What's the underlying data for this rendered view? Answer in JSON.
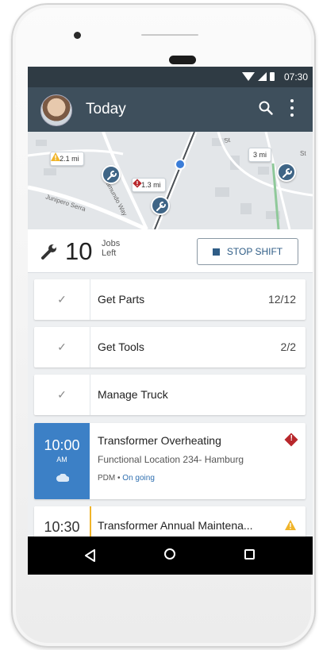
{
  "status_bar": {
    "time": "07:30"
  },
  "app_bar": {
    "title": "Today"
  },
  "map": {
    "callouts": [
      {
        "text": "2.1 mi",
        "severity": "warning"
      },
      {
        "text": "1.3 mi",
        "severity": "critical"
      },
      {
        "text": "3 mi",
        "severity": "none"
      }
    ],
    "street_labels": [
      "Junipero Serra",
      "Ramundo Way",
      "St",
      "St"
    ]
  },
  "summary": {
    "jobs_count": "10",
    "jobs_label_line1": "Jobs",
    "jobs_label_line2": "Left",
    "stop_shift_label": "STOP SHIFT"
  },
  "tasks": [
    {
      "label": "Get Parts",
      "count": "12/12",
      "done": true
    },
    {
      "label": "Get Tools",
      "count": "2/2",
      "done": true
    },
    {
      "label": "Manage Truck",
      "count": "",
      "done": true
    }
  ],
  "jobs": [
    {
      "time": "10:00",
      "ampm": "AM",
      "title": "Transformer Overheating",
      "location": "Functional Location 234- Hamburg",
      "type": "PDM",
      "status": "On going",
      "severity": "critical",
      "accent": "#3c80c6"
    },
    {
      "time": "10:30",
      "title": "Transformer Annual Maintena...",
      "severity": "warning",
      "accent": "#f0b429"
    }
  ],
  "colors": {
    "app_bar": "#3e4f5c",
    "status_bar": "#2f3b44",
    "accent_blue": "#3c80c6",
    "critical": "#b8272c",
    "warning": "#f0b429"
  }
}
